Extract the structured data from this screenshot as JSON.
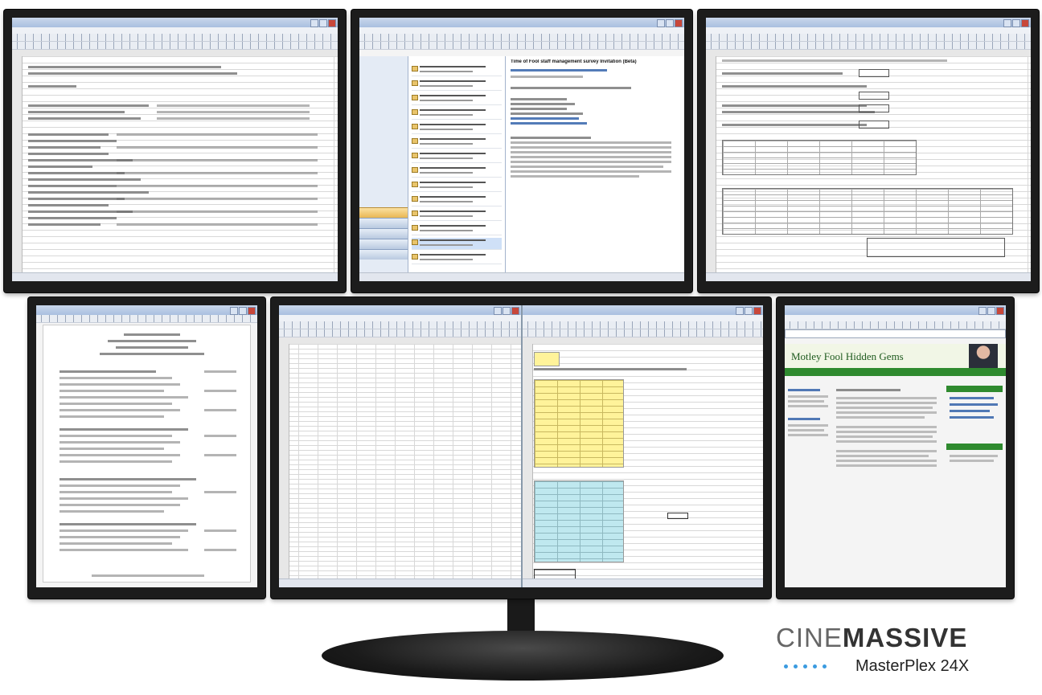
{
  "brand": {
    "name_light": "CINE",
    "name_bold": "MASSIVE",
    "model": "MasterPlex 24X",
    "accent_color": "#3b9be0"
  },
  "screens": {
    "top_center_mail_heading": "Time of Fool staff management survey Invitation (Beta)",
    "bottom_right_site_title": "Motley Fool Hidden Gems"
  },
  "colors": {
    "bezel": "#1c1c1c",
    "excel_highlight_yellow": "#fff39a",
    "excel_highlight_cyan": "#bfe8ef",
    "site_green": "#2f8a2f"
  }
}
